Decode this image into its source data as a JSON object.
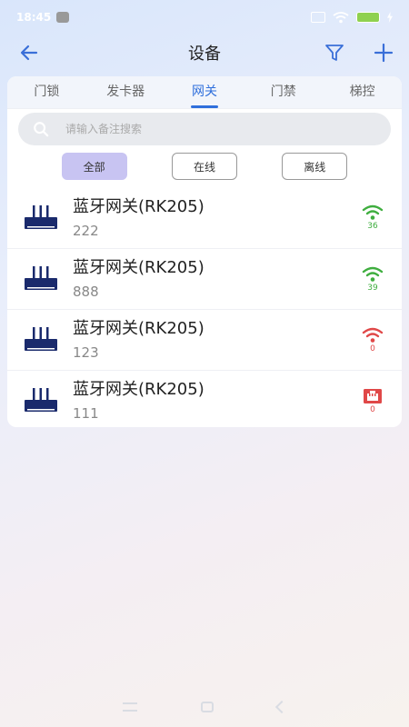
{
  "status_bar": {
    "time": "18:45",
    "battery": "68"
  },
  "header": {
    "title": "设备"
  },
  "tabs": [
    {
      "label": "门锁",
      "active": false
    },
    {
      "label": "发卡器",
      "active": false
    },
    {
      "label": "网关",
      "active": true
    },
    {
      "label": "门禁",
      "active": false
    },
    {
      "label": "梯控",
      "active": false
    }
  ],
  "search": {
    "placeholder": "请输入备注搜索"
  },
  "filters": {
    "all": "全部",
    "online": "在线",
    "offline": "离线"
  },
  "devices": [
    {
      "name": "蓝牙网关(RK205)",
      "note": "222",
      "signal": "36",
      "status": "online-wifi",
      "status_color": "#3fae3f"
    },
    {
      "name": "蓝牙网关(RK205)",
      "note": "888",
      "signal": "39",
      "status": "online-wifi",
      "status_color": "#3fae3f"
    },
    {
      "name": "蓝牙网关(RK205)",
      "note": "123",
      "signal": "0",
      "status": "offline-wifi",
      "status_color": "#e04848"
    },
    {
      "name": "蓝牙网关(RK205)",
      "note": "111",
      "signal": "0",
      "status": "offline-ethernet",
      "status_color": "#e04848"
    }
  ],
  "colors": {
    "accent": "#2f6fdc",
    "device_icon": "#1a2a6c",
    "online": "#3fae3f",
    "offline": "#e04848",
    "filter_active": "#c8c4f2"
  }
}
